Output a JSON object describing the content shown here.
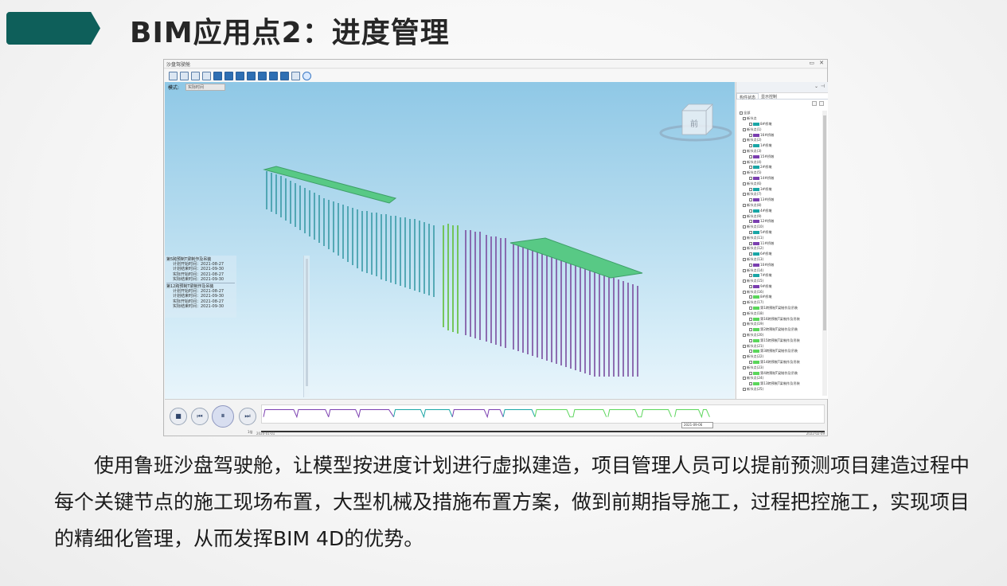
{
  "slide": {
    "title": "BIM应用点2：进度管理",
    "accent_color": "#0e5f5a",
    "body": "使用鲁班沙盘驾驶舱，让模型按进度计划进行虚拟建造，项目管理人员可以提前预测项目建造过程中每个关键节点的施工现场布置，大型机械及措施布置方案，做到前期指导施工，过程把控施工，实现项目的精细化管理，从而发挥BIM  4D的优势。"
  },
  "app": {
    "window_title": "沙盘驾驶舱",
    "mode_label": "模式:",
    "mode_value": "实际时间",
    "view_cube_label": "前",
    "info_panel": {
      "block1": {
        "title": "第5跨预制T梁制作及吊装",
        "lines": [
          "计划开始时间：2021-08-27",
          "计划结束时间：2021-09-30",
          "实际开始时间：2021-08-27",
          "实际结束时间：2021-09-30"
        ]
      },
      "block2": {
        "title": "第12跨预制T梁制作及吊装",
        "lines": [
          "计划开始时间：2021-08-27",
          "计划结束时间：2021-09-30",
          "实际开始时间：2021-08-27",
          "实际结束时间：2021-09-30"
        ]
      }
    },
    "right_panel": {
      "tabs": [
        "构件状态",
        "显示控制"
      ],
      "root": "全部",
      "colors": {
        "teal": "#1aa6a6",
        "purple": "#7b3fb0",
        "green": "#5bd65b"
      },
      "rows": [
        {
          "text": "新节点",
          "level": 1
        },
        {
          "text": "8#桥墩",
          "level": 2,
          "color": "teal"
        },
        {
          "text": "新节点(1)",
          "level": 1
        },
        {
          "text": "16#桥墩",
          "level": 2,
          "color": "purple"
        },
        {
          "text": "新节点(2)",
          "level": 1
        },
        {
          "text": "1#桥墩",
          "level": 2,
          "color": "teal"
        },
        {
          "text": "新节点(3)",
          "level": 1
        },
        {
          "text": "15#桥墩",
          "level": 2,
          "color": "purple"
        },
        {
          "text": "新节点(4)",
          "level": 1
        },
        {
          "text": "2#桥墩",
          "level": 2,
          "color": "teal"
        },
        {
          "text": "新节点(5)",
          "level": 1
        },
        {
          "text": "14#桥墩",
          "level": 2,
          "color": "purple"
        },
        {
          "text": "新节点(6)",
          "level": 1
        },
        {
          "text": "3#桥墩",
          "level": 2,
          "color": "teal"
        },
        {
          "text": "新节点(7)",
          "level": 1
        },
        {
          "text": "13#桥墩",
          "level": 2,
          "color": "purple"
        },
        {
          "text": "新节点(8)",
          "level": 1
        },
        {
          "text": "4#桥墩",
          "level": 2,
          "color": "teal"
        },
        {
          "text": "新节点(9)",
          "level": 1
        },
        {
          "text": "12#桥墩",
          "level": 2,
          "color": "purple"
        },
        {
          "text": "新节点(10)",
          "level": 1
        },
        {
          "text": "5#桥墩",
          "level": 2,
          "color": "teal"
        },
        {
          "text": "新节点(11)",
          "level": 1
        },
        {
          "text": "11#桥墩",
          "level": 2,
          "color": "purple"
        },
        {
          "text": "新节点(12)",
          "level": 1
        },
        {
          "text": "6#桥墩",
          "level": 2,
          "color": "teal"
        },
        {
          "text": "新节点(13)",
          "level": 1
        },
        {
          "text": "10#桥墩",
          "level": 2,
          "color": "purple"
        },
        {
          "text": "新节点(14)",
          "level": 1
        },
        {
          "text": "7#桥墩",
          "level": 2,
          "color": "teal"
        },
        {
          "text": "新节点(15)",
          "level": 1
        },
        {
          "text": "9#桥墩",
          "level": 2,
          "color": "purple"
        },
        {
          "text": "新节点(16)",
          "level": 1
        },
        {
          "text": "8#桥墩",
          "level": 2,
          "color": "green"
        },
        {
          "text": "新节点(17)",
          "level": 1
        },
        {
          "text": "第1跨预制T梁制作及吊装",
          "level": 2,
          "color": "green"
        },
        {
          "text": "新节点(18)",
          "level": 1
        },
        {
          "text": "第16跨预制T梁制作及吊装",
          "level": 2,
          "color": "green"
        },
        {
          "text": "新节点(19)",
          "level": 1
        },
        {
          "text": "第2跨预制T梁制作及吊装",
          "level": 2,
          "color": "green"
        },
        {
          "text": "新节点(20)",
          "level": 1
        },
        {
          "text": "第15跨预制T梁制作及吊装",
          "level": 2,
          "color": "green"
        },
        {
          "text": "新节点(21)",
          "level": 1
        },
        {
          "text": "第3跨预制T梁制作及吊装",
          "level": 2,
          "color": "green"
        },
        {
          "text": "新节点(22)",
          "level": 1
        },
        {
          "text": "第14跨预制T梁制作及吊装",
          "level": 2,
          "color": "green"
        },
        {
          "text": "新节点(23)",
          "level": 1
        },
        {
          "text": "第4跨预制T梁制作及吊装",
          "level": 2,
          "color": "green"
        },
        {
          "text": "新节点(24)",
          "level": 1
        },
        {
          "text": "第13跨预制T梁制作及吊装",
          "level": 2,
          "color": "green"
        },
        {
          "text": "新节点(25)",
          "level": 1
        }
      ]
    },
    "playback": {
      "stop_icon": "■",
      "prev_icon": "⏮",
      "pause_icon": "⏸",
      "next_icon": "⏭",
      "speed_label": "1倍",
      "start_date": "2020-01-01",
      "current_date": "2021-09-06",
      "end_date": "2022-02-09"
    }
  }
}
